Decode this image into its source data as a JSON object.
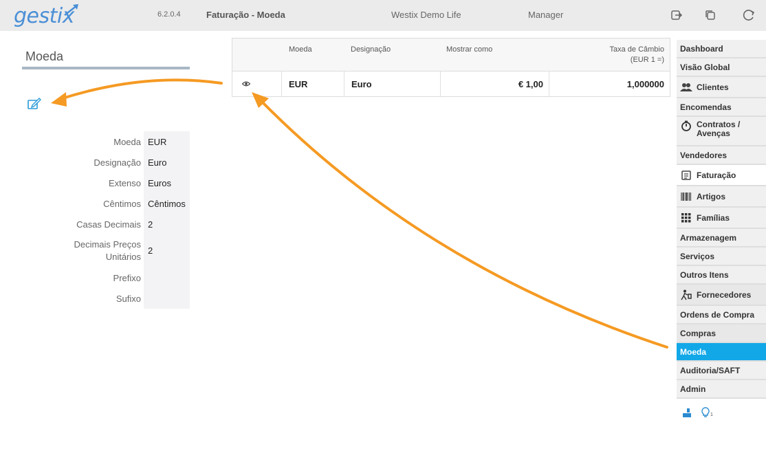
{
  "app": {
    "logo_text": "gestix",
    "version": "6.2.0.4",
    "module_title": "Faturação - Moeda",
    "company": "Westix Demo Life",
    "user_role": "Manager"
  },
  "toolbar_icons": [
    "logout-icon",
    "window-icon",
    "refresh-icon"
  ],
  "panel": {
    "title": "Moeda",
    "fields": [
      {
        "label": "Moeda",
        "value": "EUR"
      },
      {
        "label": "Designação",
        "value": "Euro"
      },
      {
        "label": "Extenso",
        "value": "Euros"
      },
      {
        "label": "Cêntimos",
        "value": "Cêntimos"
      },
      {
        "label": "Casas Decimais",
        "value": "2"
      },
      {
        "label": "Decimais Preços Unitários",
        "value": "2"
      },
      {
        "label": "Prefixo",
        "value": ""
      },
      {
        "label": "Sufixo",
        "value": ""
      }
    ]
  },
  "table": {
    "headers": {
      "moeda": "Moeda",
      "designacao": "Designação",
      "mostrar": "Mostrar como",
      "taxa_line1": "Taxa de Câmbio",
      "taxa_line2": "(EUR 1 =)"
    },
    "rows": [
      {
        "moeda": "EUR",
        "designacao": "Euro",
        "mostrar": "€ 1,00",
        "taxa": "1,000000"
      }
    ]
  },
  "sidebar": {
    "items": [
      {
        "label": "Dashboard",
        "icon": ""
      },
      {
        "label": "Visão Global",
        "icon": ""
      },
      {
        "label": "Clientes",
        "icon": "users-icon"
      },
      {
        "label": "Encomendas",
        "icon": ""
      },
      {
        "label": "Contratos / Avenças",
        "icon": "stopwatch-icon"
      },
      {
        "label": "Vendedores",
        "icon": ""
      },
      {
        "label": "Faturação",
        "icon": "invoice-icon"
      },
      {
        "label": "Artigos",
        "icon": "barcode-icon"
      },
      {
        "label": "Famílias",
        "icon": "grid-icon"
      },
      {
        "label": "Armazenagem",
        "icon": ""
      },
      {
        "label": "Serviços",
        "icon": ""
      },
      {
        "label": "Outros Itens",
        "icon": ""
      },
      {
        "label": "Fornecedores",
        "icon": "delivery-icon"
      },
      {
        "label": "Ordens de Compra",
        "icon": ""
      },
      {
        "label": "Compras",
        "icon": ""
      },
      {
        "label": "Moeda",
        "icon": ""
      },
      {
        "label": "Auditoria/SAFT",
        "icon": ""
      },
      {
        "label": "Admin",
        "icon": ""
      }
    ],
    "active": "Moeda"
  },
  "footer": {
    "notification_count": "1"
  },
  "colors": {
    "accent": "#12a8e8",
    "annotation": "#f59a23",
    "logo": "#4a8fd6"
  }
}
